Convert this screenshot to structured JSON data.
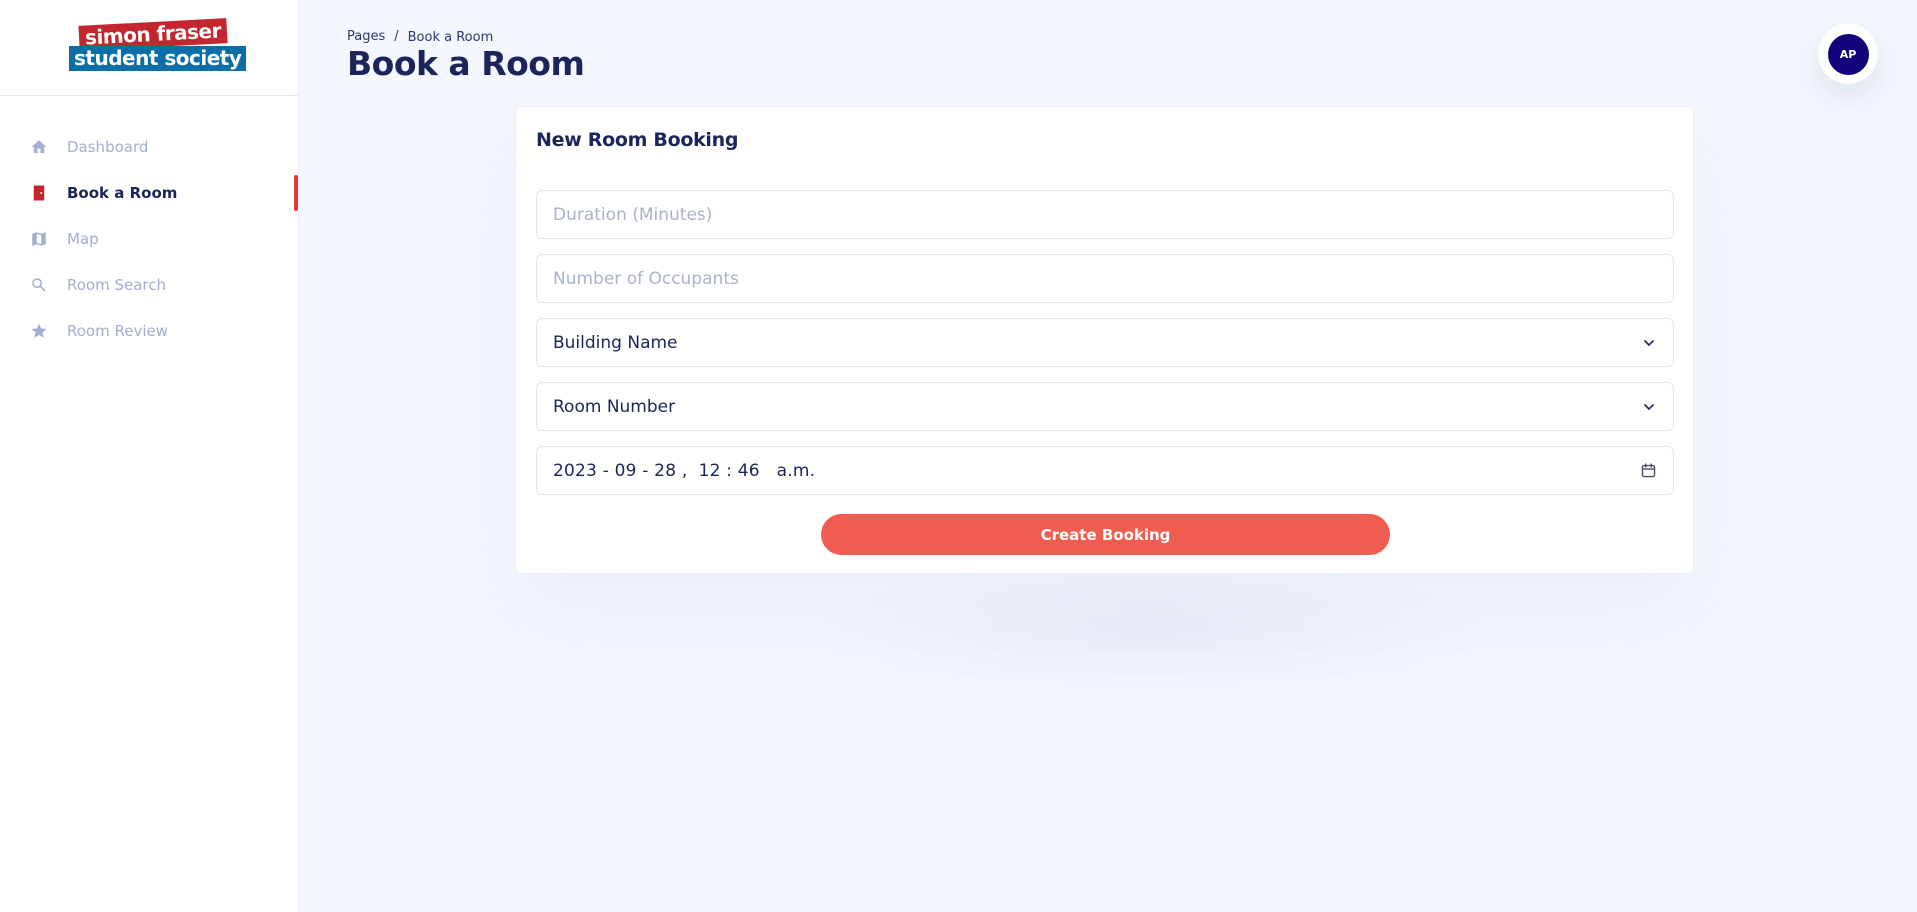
{
  "brand": {
    "logo_line1": "simon fraser",
    "logo_line2": "student society",
    "logo_red": "#c3262e",
    "logo_blue": "#0b6ea7"
  },
  "sidebar": {
    "items": [
      {
        "label": "Dashboard",
        "icon": "home-icon",
        "active": false
      },
      {
        "label": "Book a Room",
        "icon": "door-icon",
        "active": true
      },
      {
        "label": "Map",
        "icon": "map-icon",
        "active": false
      },
      {
        "label": "Room Search",
        "icon": "search-icon",
        "active": false
      },
      {
        "label": "Room Review",
        "icon": "star-icon",
        "active": false
      }
    ],
    "active_color": "#e53535"
  },
  "header": {
    "breadcrumb_root": "Pages",
    "breadcrumb_sep": "/",
    "breadcrumb_current": "Book a Room",
    "title": "Book a Room"
  },
  "user": {
    "initials": "AP",
    "avatar_color": "#11047a"
  },
  "form": {
    "title": "New Room Booking",
    "duration_placeholder": "Duration (Minutes)",
    "occupants_placeholder": "Number of Occupants",
    "building_label": "Building Name",
    "room_label": "Room Number",
    "datetime_value": "2023 - 09 - 28 ,  12 : 46   a.m.",
    "submit_label": "Create Booking",
    "submit_color": "#ef5d50"
  }
}
